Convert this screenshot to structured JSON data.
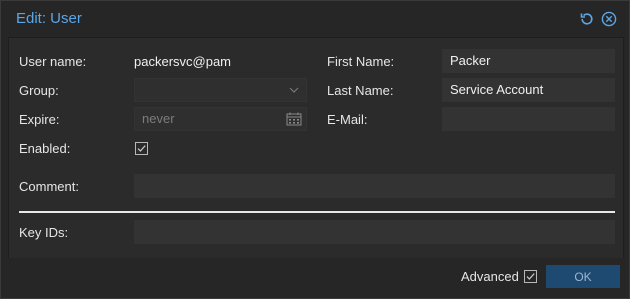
{
  "window": {
    "title": "Edit: User",
    "tools": [
      {
        "name": "reset-icon"
      },
      {
        "name": "close-icon"
      }
    ]
  },
  "form": {
    "username_label": "User name:",
    "username_value": "packersvc@pam",
    "group_label": "Group:",
    "group_value": "",
    "expire_label": "Expire:",
    "expire_placeholder": "never",
    "enabled_label": "Enabled:",
    "enabled_checked": true,
    "firstname_label": "First Name:",
    "firstname_value": "Packer",
    "lastname_label": "Last Name:",
    "lastname_value": "Service Account",
    "email_label": "E-Mail:",
    "email_value": "",
    "comment_label": "Comment:",
    "comment_value": "",
    "keyids_label": "Key IDs:",
    "keyids_value": ""
  },
  "footer": {
    "advanced_label": "Advanced",
    "advanced_checked": true,
    "ok_label": "OK"
  },
  "colors": {
    "accent": "#5aa6e6",
    "ok_button": "#1e4a72"
  }
}
